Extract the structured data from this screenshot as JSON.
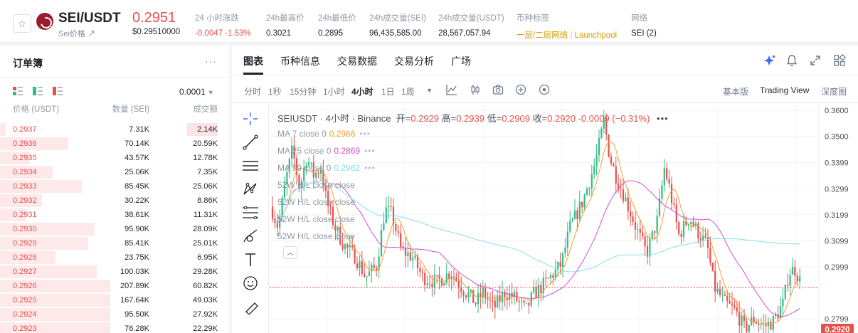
{
  "header": {
    "pair": "SEI/USDT",
    "subtitle": "Sei价格 ↗",
    "last_price": "0.2951",
    "last_usd": "$0.29510000",
    "stats": [
      {
        "label": "24 小时涨跌",
        "value": "-0.0047 -1.53%",
        "color": "red"
      },
      {
        "label": "24h最高价",
        "value": "0.3021"
      },
      {
        "label": "24h最低价",
        "value": "0.2895"
      },
      {
        "label": "24h成交量(SEI)",
        "value": "96,435,585.00"
      },
      {
        "label": "24h成交量(USDT)",
        "value": "28,567,057.94"
      },
      {
        "label": "币种标签",
        "value_a": "一层/二层网络",
        "value_sep": " | ",
        "value_b": "Launchpool"
      },
      {
        "label": "网络",
        "value": "SEI (2)"
      }
    ]
  },
  "orderbook": {
    "title": "订单簿",
    "precision": "0.0001",
    "col_price": "价格 (USDT)",
    "col_qty": "数量 (SEI)",
    "col_total": "成交额",
    "rows": [
      {
        "price": "0.2937",
        "qty": "7.31K",
        "total": "2.14K",
        "depth": 0.05
      },
      {
        "price": "0.2936",
        "qty": "70.14K",
        "total": "20.59K",
        "depth": 0.62
      },
      {
        "price": "0.2935",
        "qty": "43.57K",
        "total": "12.78K",
        "depth": 0.27
      },
      {
        "price": "0.2934",
        "qty": "25.06K",
        "total": "7.35K",
        "depth": 0.48
      },
      {
        "price": "0.2933",
        "qty": "85.45K",
        "total": "25.06K",
        "depth": 0.74
      },
      {
        "price": "0.2932",
        "qty": "30.22K",
        "total": "8.86K",
        "depth": 0.38
      },
      {
        "price": "0.2931",
        "qty": "38.61K",
        "total": "11.31K",
        "depth": 0.23
      },
      {
        "price": "0.2930",
        "qty": "95.90K",
        "total": "28.09K",
        "depth": 0.86
      },
      {
        "price": "0.2929",
        "qty": "85.41K",
        "total": "25.01K",
        "depth": 0.8
      },
      {
        "price": "0.2928",
        "qty": "23.75K",
        "total": "6.95K",
        "depth": 0.5
      },
      {
        "price": "0.2927",
        "qty": "100.03K",
        "total": "29.28K",
        "depth": 0.88
      },
      {
        "price": "0.2926",
        "qty": "207.89K",
        "total": "60.82K",
        "depth": 1.0
      },
      {
        "price": "0.2925",
        "qty": "167.64K",
        "total": "49.03K",
        "depth": 1.0
      },
      {
        "price": "0.2924",
        "qty": "95.50K",
        "total": "27.92K",
        "depth": 1.0
      },
      {
        "price": "0.2923",
        "qty": "76.28K",
        "total": "22.29K",
        "depth": 1.0
      }
    ]
  },
  "tabs": [
    "图表",
    "币种信息",
    "交易数据",
    "交易分析",
    "广场"
  ],
  "timeframes": [
    "分时",
    "1秒",
    "15分钟",
    "1小时",
    "4小时",
    "1日",
    "1周"
  ],
  "active_timeframe": "4小时",
  "views": [
    "基本版",
    "Trading View",
    "深度图"
  ],
  "active_view": "Trading View",
  "chart_legend": {
    "symbol": "SEIUSDT · 4小时 · Binance",
    "open_label": "开=",
    "open": "0.2929",
    "high_label": "高=",
    "high": "0.2939",
    "low_label": "低=",
    "low": "0.2909",
    "close_label": "收=",
    "close": "0.2920",
    "change": "-0.0009 (−0.31%)",
    "indicators": [
      {
        "name": "MA 7 close 0",
        "value": "0.2966",
        "color": "#f0a030"
      },
      {
        "name": "MA 25 close 0",
        "value": "0.2869",
        "color": "#d64fd6"
      },
      {
        "name": "MA 99 close 0",
        "value": "0.2962",
        "color": "#7fe3e8"
      },
      {
        "name": "52W H/L close close",
        "value": ""
      },
      {
        "name": "52W H/L close close",
        "value": ""
      },
      {
        "name": "52W H/L close close",
        "value": ""
      },
      {
        "name": "52W H/L close close",
        "value": ""
      }
    ]
  },
  "chart_data": {
    "type": "candlestick",
    "y_ticks": [
      "0.3600",
      "0.3500",
      "0.3399",
      "0.3299",
      "0.3199",
      "0.3099",
      "0.2999",
      "0.2799"
    ],
    "y_range": [
      0.2745,
      0.3625
    ],
    "current_price": "0.2920",
    "ma_colors": {
      "ma7": "#f0a030",
      "ma25": "#d64fd6",
      "ma99": "#7fe3e8"
    },
    "up_color": "#2ebd85",
    "down_color": "#e8504d"
  }
}
